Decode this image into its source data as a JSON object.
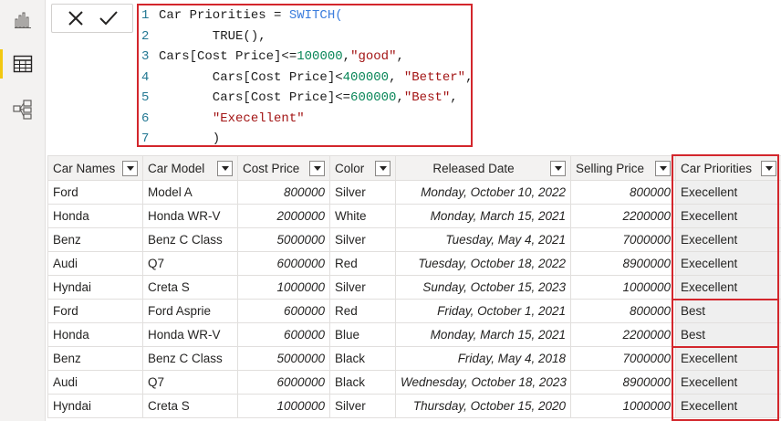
{
  "formula_bar": {
    "code_lines": [
      {
        "n": "1",
        "segments": [
          {
            "t": "Car Priorities = ",
            "c": ""
          },
          {
            "t": "SWITCH(",
            "c": "kw"
          }
        ]
      },
      {
        "n": "2",
        "segments": [
          {
            "t": "       TRUE(),",
            "c": ""
          }
        ]
      },
      {
        "n": "3",
        "segments": [
          {
            "t": "Cars[Cost Price]<=",
            "c": ""
          },
          {
            "t": "100000",
            "c": "num"
          },
          {
            "t": ",",
            "c": ""
          },
          {
            "t": "\"good\"",
            "c": "str"
          },
          {
            "t": ",",
            "c": ""
          }
        ]
      },
      {
        "n": "4",
        "segments": [
          {
            "t": "       Cars[Cost Price]<",
            "c": ""
          },
          {
            "t": "400000",
            "c": "num"
          },
          {
            "t": ", ",
            "c": ""
          },
          {
            "t": "\"Better\"",
            "c": "str"
          },
          {
            "t": ",",
            "c": ""
          }
        ]
      },
      {
        "n": "5",
        "segments": [
          {
            "t": "       Cars[Cost Price]<=",
            "c": ""
          },
          {
            "t": "600000",
            "c": "num"
          },
          {
            "t": ",",
            "c": ""
          },
          {
            "t": "\"Best\"",
            "c": "str"
          },
          {
            "t": ",",
            "c": ""
          }
        ]
      },
      {
        "n": "6",
        "segments": [
          {
            "t": "       ",
            "c": ""
          },
          {
            "t": "\"Execellent\"",
            "c": "str"
          }
        ]
      },
      {
        "n": "7",
        "segments": [
          {
            "t": "       )",
            "c": ""
          }
        ]
      }
    ]
  },
  "table": {
    "columns": [
      "Car Names",
      "Car Model",
      "Cost Price",
      "Color",
      "Released Date",
      "Selling Price",
      "Car Priorities"
    ],
    "rows": [
      [
        "Ford",
        "Model A",
        "800000",
        "Silver",
        "Monday, October 10, 2022",
        "800000",
        "Execellent"
      ],
      [
        "Honda",
        "Honda WR-V",
        "2000000",
        "White",
        "Monday, March 15, 2021",
        "2200000",
        "Execellent"
      ],
      [
        "Benz",
        "Benz C Class",
        "5000000",
        "Silver",
        "Tuesday, May 4, 2021",
        "7000000",
        "Execellent"
      ],
      [
        "Audi",
        "Q7",
        "6000000",
        "Red",
        "Tuesday, October 18, 2022",
        "8900000",
        "Execellent"
      ],
      [
        "Hyndai",
        "Creta S",
        "1000000",
        "Silver",
        "Sunday, October 15, 2023",
        "1000000",
        "Execellent"
      ],
      [
        "Ford",
        "Ford Asprie",
        "600000",
        "Red",
        "Friday, October 1, 2021",
        "800000",
        "Best"
      ],
      [
        "Honda",
        "Honda WR-V",
        "600000",
        "Blue",
        "Monday, March 15, 2021",
        "2200000",
        "Best"
      ],
      [
        "Benz",
        "Benz C Class",
        "5000000",
        "Black",
        "Friday, May 4, 2018",
        "7000000",
        "Execellent"
      ],
      [
        "Audi",
        "Q7",
        "6000000",
        "Black",
        "Wednesday, October 18, 2023",
        "8900000",
        "Execellent"
      ],
      [
        "Hyndai",
        "Creta S",
        "1000000",
        "Silver",
        "Thursday, October 15, 2020",
        "1000000",
        "Execellent"
      ]
    ]
  },
  "icons": {
    "rail": [
      "report-view-icon",
      "table-view-icon",
      "model-view-icon"
    ],
    "formula": [
      "cancel-icon",
      "commit-icon"
    ]
  },
  "colors": {
    "highlight": "#d3262c",
    "active_indicator": "#f2c811",
    "keyword": "#3b7ddd",
    "number": "#098658",
    "string": "#a31515"
  }
}
